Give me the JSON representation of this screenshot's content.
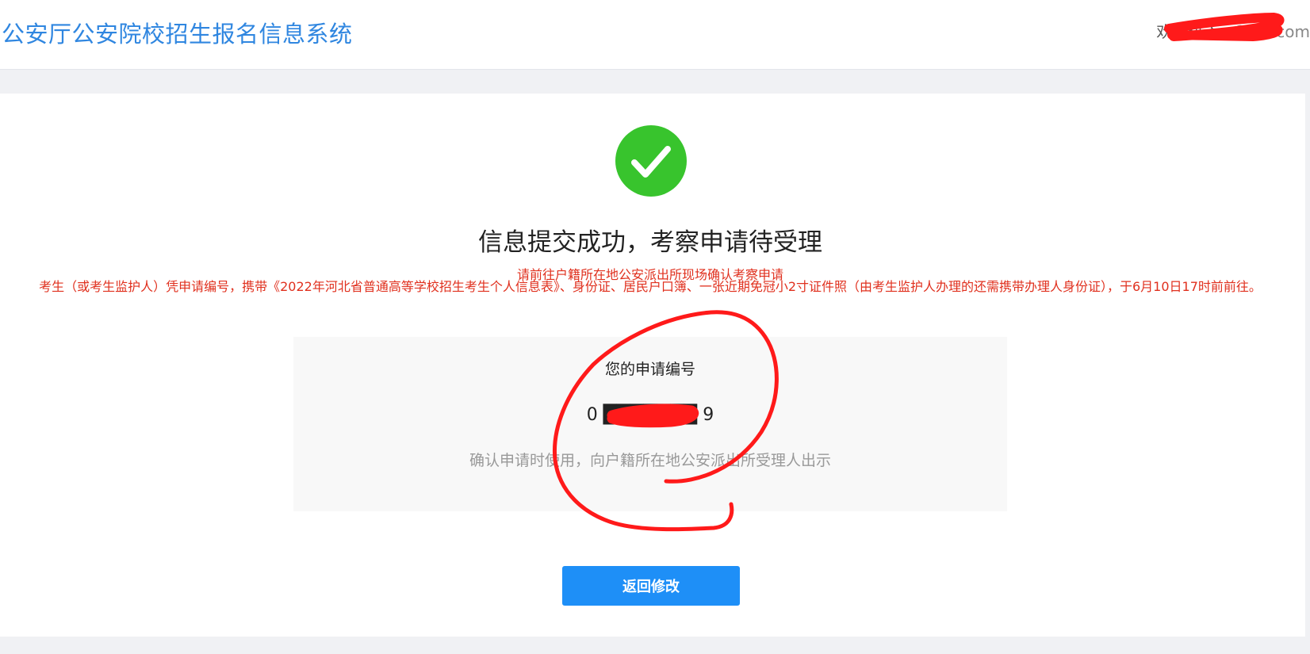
{
  "header": {
    "title": "公安厅公安院校招生报名信息系统",
    "welcome_prefix": "欢迎进入，",
    "user_visible_fragment": "2 ... .com"
  },
  "result": {
    "title": "信息提交成功，考察申请待受理",
    "notice_heading": "请前往户籍所在地公安派出所现场确认考察申请",
    "notice_body": "考生（或考生监护人）凭申请编号，携带《2022年河北省普通高等学校招生考生个人信息表》、身份证、居民户口簿、一张近期免冠小2寸证件照（由考生监护人办理的还需携带办理人身份证），于6月10日17时前前往。"
  },
  "application": {
    "label": "您的申请编号",
    "number": "0 ███████ 9",
    "hint": "确认申请时使用，向户籍所在地公安派出所受理人出示"
  },
  "actions": {
    "return_label": "返回修改"
  },
  "colors": {
    "title_blue": "#2f86e0",
    "success_green": "#38c42d",
    "notice_red": "#e0301e",
    "button_blue": "#1e8ff7",
    "redaction_red": "#ff1a1a"
  },
  "icons": {
    "status": "check-circle-icon"
  }
}
